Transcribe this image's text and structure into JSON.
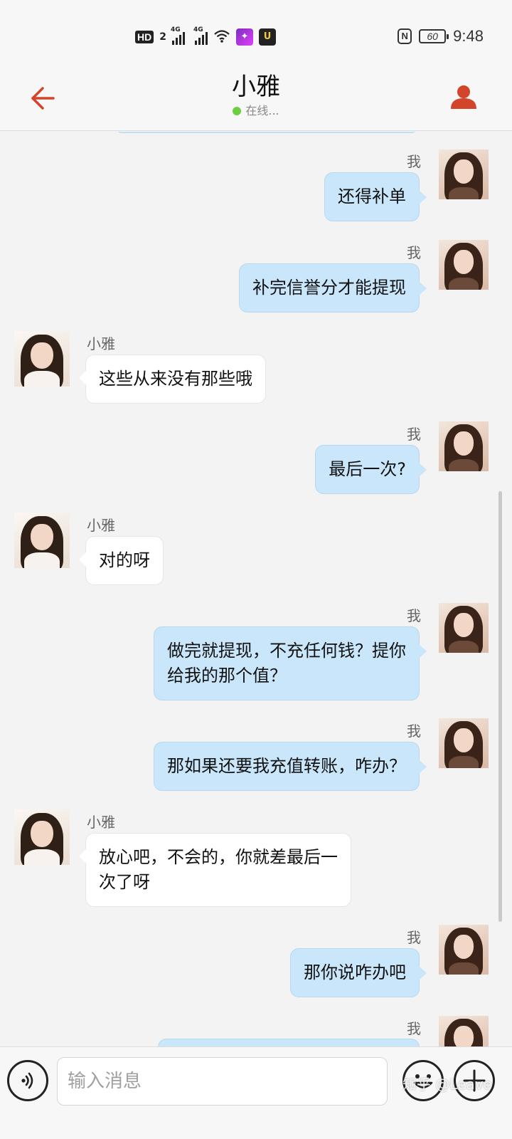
{
  "status_bar": {
    "hd_label": "HD",
    "sim_number": "2",
    "network_1": "4G",
    "network_2": "4G",
    "nfc_label": "N",
    "battery": "60",
    "time": "9:48"
  },
  "header": {
    "back_icon": "arrow-left-icon",
    "title": "小雅",
    "status": "在线...",
    "profile_icon": "person-icon",
    "accent_color": "#d2452a"
  },
  "chat": {
    "my_name": "我",
    "contact_name": "小雅",
    "messages": [
      {
        "from": "me",
        "sender": "我",
        "text": "还得补单"
      },
      {
        "from": "me",
        "sender": "我",
        "text": "补完信誉分才能提现"
      },
      {
        "from": "contact",
        "sender": "小雅",
        "text": "这些从来没有那些哦"
      },
      {
        "from": "me",
        "sender": "我",
        "text": "最后一次?"
      },
      {
        "from": "contact",
        "sender": "小雅",
        "text": "对的呀"
      },
      {
        "from": "me",
        "sender": "我",
        "lines": [
          "做完就提现，不充任何钱？提你",
          "给我的那个值？"
        ]
      },
      {
        "from": "me",
        "sender": "我",
        "text": "那如果还要我充值转账，咋办？"
      },
      {
        "from": "contact",
        "sender": "小雅",
        "lines": [
          "放心吧，不会的，你就差最后一",
          "次了呀"
        ]
      },
      {
        "from": "me",
        "sender": "我",
        "text": "那你说咋办吧"
      },
      {
        "from": "me",
        "sender": "我",
        "text": ""
      }
    ],
    "colors": {
      "outgoing_bubble": "#c9e6fb",
      "incoming_bubble": "#ffffff",
      "background": "#f3f3f3"
    }
  },
  "input_bar": {
    "voice_icon": "voice-icon",
    "placeholder": "输入消息",
    "emoji_icon": "emoji-icon",
    "plus_icon": "plus-icon"
  },
  "watermark": "知乎 @Leave"
}
